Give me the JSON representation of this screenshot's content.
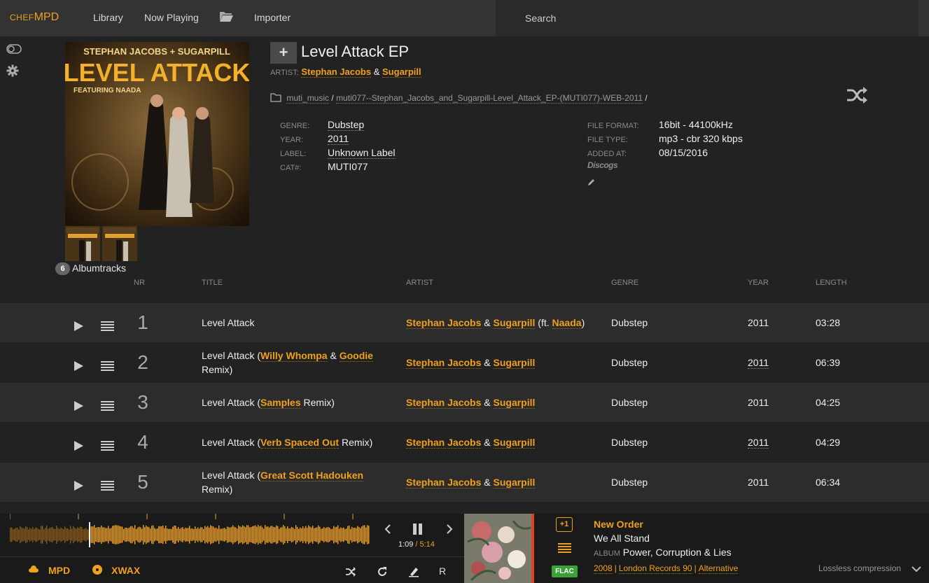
{
  "app": {
    "logo_small": "CHEF",
    "logo_big": "MPD"
  },
  "nav": {
    "library": "Library",
    "now_playing": "Now Playing",
    "importer": "Importer"
  },
  "search": {
    "placeholder": "Search"
  },
  "album": {
    "title": "Level Attack EP",
    "artist_label": "ARTIST:",
    "artists": [
      "Stephan Jacobs",
      "Sugarpill"
    ],
    "artist_sep": "&",
    "path": [
      "muti_music",
      "muti077--Stephan_Jacobs_and_Sugarpill-Level_Attack_EP-(MUTI077)-WEB-2011"
    ],
    "path_sep": "/",
    "meta_left": [
      {
        "label": "GENRE:",
        "value": "Dubstep"
      },
      {
        "label": "YEAR:",
        "value": "2011"
      },
      {
        "label": "LABEL:",
        "value": "Unknown Label"
      },
      {
        "label": "CAT#:",
        "value": "MUTI077"
      }
    ],
    "meta_right": [
      {
        "label": "FILE FORMAT:",
        "value": "16bit - 44100kHz"
      },
      {
        "label": "FILE TYPE:",
        "value": "mp3 - cbr 320 kbps"
      },
      {
        "label": "ADDED AT:",
        "value": "08/15/2016"
      }
    ],
    "discogs": "Discogs",
    "cover_text": {
      "artists": "STEPHAN JACOBS + SUGARPILL",
      "title": "LEVEL ATTACK",
      "featuring": "FEATURING NAADA"
    }
  },
  "tracks_count": "6",
  "tracks_label": "Albumtracks",
  "columns": {
    "nr": "NR",
    "title": "TITLE",
    "artist": "ARTIST",
    "genre": "GENRE",
    "year": "YEAR",
    "length": "LENGTH"
  },
  "tracks": [
    {
      "nr": "1",
      "title": "Level Attack",
      "remix": "",
      "title_suffix": "",
      "artist1": "Stephan Jacobs",
      "artist2": "Sugarpill",
      "feat": "Naada",
      "genre": "Dubstep",
      "year": "2011",
      "length": "03:28"
    },
    {
      "nr": "2",
      "title": "Level Attack (",
      "remix": "Willy Whompa",
      "remix2": "Goodie",
      "title_suffix": "Remix)",
      "artist1": "Stephan Jacobs",
      "artist2": "Sugarpill",
      "genre": "Dubstep",
      "year": "2011",
      "length": "06:39"
    },
    {
      "nr": "3",
      "title": "Level Attack (",
      "remix": "Samples",
      "title_suffix": " Remix)",
      "artist1": "Stephan Jacobs",
      "artist2": "Sugarpill",
      "genre": "Dubstep",
      "year": "2011",
      "length": "04:25"
    },
    {
      "nr": "4",
      "title": "Level Attack (",
      "remix": "Verb Spaced Out",
      "title_suffix": " Remix)",
      "artist1": "Stephan Jacobs",
      "artist2": "Sugarpill",
      "genre": "Dubstep",
      "year": "2011",
      "length": "04:29"
    },
    {
      "nr": "5",
      "title": "Level Attack (",
      "remix": "Great Scott Hadouken",
      "title_suffix": "Remix)",
      "artist1": "Stephan Jacobs",
      "artist2": "Sugarpill",
      "genre": "Dubstep",
      "year": "2011",
      "length": "06:34"
    }
  ],
  "feat_prefix": " (ft. ",
  "feat_suffix": ")",
  "amp": "&",
  "player": {
    "current_time": "1:09",
    "total_time": "5:14",
    "time_sep": "/",
    "progress": 0.22,
    "sources": [
      "MPD",
      "XWAX"
    ],
    "repeat_label": "R",
    "plus_one": "+1",
    "format_badge": "FLAC",
    "artist": "New Order",
    "title": "We All Stand",
    "album_label": "ALBUM",
    "album": "Power, Corruption & Lies",
    "year": "2008",
    "label": "London Records 90",
    "genre": "Alternative",
    "meta_sep": "|",
    "compression": "Lossless compression"
  },
  "colors": {
    "accent": "#f0a020",
    "bg": "#222222",
    "topbar": "#333333",
    "row_alt": "#2c2c2c",
    "flac": "#3aa03a"
  }
}
